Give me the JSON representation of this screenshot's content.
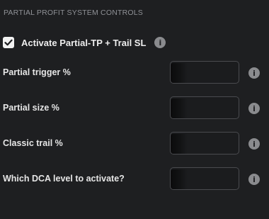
{
  "section": {
    "title": "PARTIAL PROFIT SYSTEM CONTROLS"
  },
  "activate": {
    "label": "Activate Partial-TP + Trail SL",
    "checked": true
  },
  "fields": [
    {
      "label": "Partial trigger %",
      "value": ""
    },
    {
      "label": "Partial size %",
      "value": ""
    },
    {
      "label": "Classic trail %",
      "value": ""
    },
    {
      "label": "Which DCA level to activate?",
      "value": ""
    }
  ],
  "icons": {
    "info": "i",
    "check": "checkmark-icon"
  }
}
